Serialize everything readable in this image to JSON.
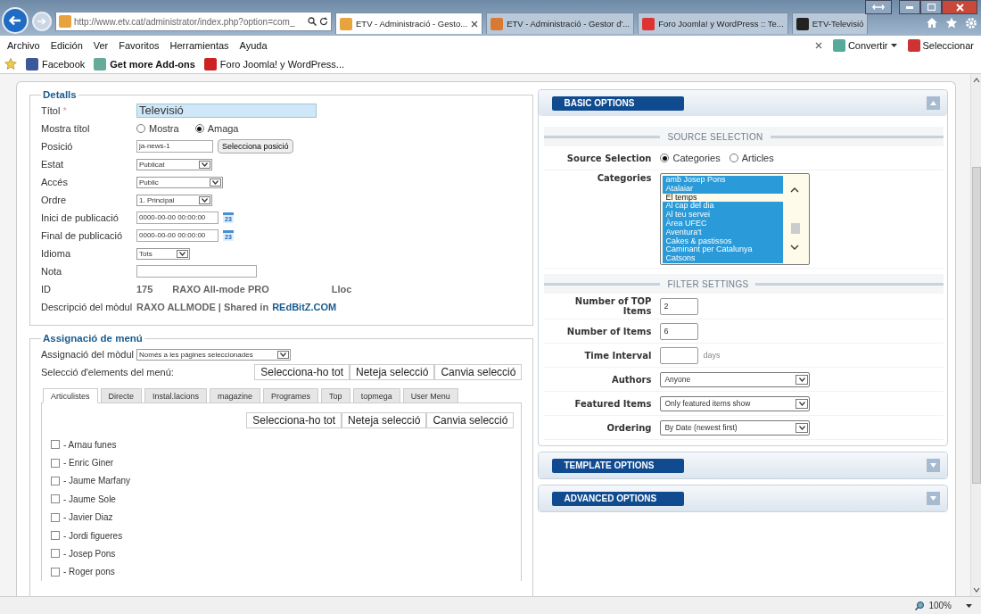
{
  "browser": {
    "address": "http://www.etv.cat/administrator/index.php?option=com_",
    "tabs": [
      {
        "label": "ETV - Administració - Gesto...",
        "selected": true
      },
      {
        "label": "ETV - Administració - Gestor d'...",
        "selected": false
      },
      {
        "label": "Foro Joomla! y WordPress :: Te...",
        "selected": false
      },
      {
        "label": "ETV-Televisió",
        "selected": false
      }
    ],
    "menu": [
      "Archivo",
      "Edición",
      "Ver",
      "Favoritos",
      "Herramientas",
      "Ayuda"
    ],
    "tools": [
      "Convertir",
      "Seleccionar"
    ],
    "favorites": [
      {
        "label": "Facebook",
        "bold": false
      },
      {
        "label": "Get more Add-ons",
        "bold": true
      },
      {
        "label": "Foro Joomla! y WordPress...",
        "bold": false
      }
    ]
  },
  "details": {
    "legend": "Detalls",
    "rows": [
      {
        "kind": "title",
        "label": "Títol",
        "required": "*",
        "value": "Televisió"
      },
      {
        "kind": "radio",
        "label": "Mostra títol",
        "options": [
          {
            "label": "Mostra",
            "selected": false
          },
          {
            "label": "Amaga",
            "selected": true
          }
        ]
      },
      {
        "kind": "position",
        "label": "Posició",
        "value": "ja-news-1",
        "button": "Selecciona posició"
      },
      {
        "kind": "select",
        "label": "Estat",
        "value": "Publicat"
      },
      {
        "kind": "select",
        "label": "Accés",
        "value": "Public"
      },
      {
        "kind": "select",
        "label": "Ordre",
        "value": "1. Principal"
      },
      {
        "kind": "date",
        "label": "Inici de publicació",
        "value": "0000-00-00 00:00:00",
        "icon": "23"
      },
      {
        "kind": "date",
        "label": "Final de publicació",
        "value": "0000-00-00 00:00:00",
        "icon": "23"
      },
      {
        "kind": "select",
        "label": "Idioma",
        "value": "Tots"
      },
      {
        "kind": "text",
        "label": "Nota"
      },
      {
        "kind": "info",
        "label": "ID",
        "values": [
          "175",
          "RAXO All-mode PRO",
          "Lloc"
        ]
      },
      {
        "kind": "description",
        "label": "Descripció del mòdul",
        "text": "RAXO ALLMODE | Shared in",
        "link": "REdBitZ.COM"
      }
    ]
  },
  "menu_assignment": {
    "legend": "Assignació de menú",
    "assignment": {
      "label": "Assignació del mòdul",
      "value": "Només a les pàgines seleccionades"
    },
    "selection_label": "Selecció d'elements del menú:",
    "buttons": [
      "Selecciona-ho tot",
      "Neteja selecció",
      "Canvia selecció"
    ],
    "tabs": [
      {
        "label": "Articulistes",
        "selected": true
      },
      {
        "label": "Directe",
        "selected": false
      },
      {
        "label": "Instal.lacions",
        "selected": false
      },
      {
        "label": "magazine",
        "selected": false
      },
      {
        "label": "Programes",
        "selected": false
      },
      {
        "label": "Top",
        "selected": false
      },
      {
        "label": "topmega",
        "selected": false
      },
      {
        "label": "User Menu",
        "selected": false
      }
    ],
    "inner_buttons": [
      "Selecciona-ho tot",
      "Neteja selecció",
      "Canvia selecció"
    ],
    "items": [
      {
        "label": "- Arnau funes",
        "checked": false
      },
      {
        "label": "- Enric Giner",
        "checked": false
      },
      {
        "label": "- Jaume Marfany",
        "checked": false
      },
      {
        "label": "- Jaume Sole",
        "checked": false
      },
      {
        "label": "- Javier Diaz",
        "checked": false
      },
      {
        "label": "- Jordi figueres",
        "checked": false
      },
      {
        "label": "- Josep Pons",
        "checked": false
      },
      {
        "label": "- Roger pons",
        "checked": false
      }
    ]
  },
  "panels": [
    {
      "title": "BASIC OPTIONS",
      "expanded": true
    },
    {
      "title": "TEMPLATE OPTIONS",
      "expanded": false
    },
    {
      "title": "ADVANCED OPTIONS",
      "expanded": false
    }
  ],
  "basic_options": {
    "source_heading": "SOURCE SELECTION",
    "source": {
      "label": "Source Selection",
      "options": [
        {
          "label": "Categories",
          "selected": true
        },
        {
          "label": "Articles",
          "selected": false
        }
      ]
    },
    "categories": {
      "label": "Categories",
      "items": [
        {
          "label": "amb Josep Pons",
          "selected": true
        },
        {
          "label": "Atalaiar",
          "selected": true
        },
        {
          "label": "El temps",
          "selected": false
        },
        {
          "label": "Al cap del dia",
          "selected": true
        },
        {
          "label": "Al teu servei",
          "selected": true
        },
        {
          "label": "Àrea UFEC",
          "selected": true
        },
        {
          "label": "Aventura't",
          "selected": true
        },
        {
          "label": "Cakes & pastissos",
          "selected": true
        },
        {
          "label": "Caminant per Catalunya",
          "selected": true
        },
        {
          "label": "Catsons",
          "selected": true
        }
      ]
    },
    "filter_heading": "FILTER SETTINGS",
    "fields": [
      {
        "kind": "number",
        "label": "Number of TOP Items",
        "value": "2"
      },
      {
        "kind": "number",
        "label": "Number of Items",
        "value": "6"
      },
      {
        "kind": "number",
        "label": "Time Interval",
        "unit": "days"
      },
      {
        "kind": "select",
        "label": "Authors",
        "value": "Anyone"
      },
      {
        "kind": "select",
        "label": "Featured Items",
        "value": "Only featured items show"
      },
      {
        "kind": "select",
        "label": "Ordering",
        "value": "By Date (newest first)"
      }
    ]
  },
  "status_bar": {
    "zoom": "100%"
  }
}
